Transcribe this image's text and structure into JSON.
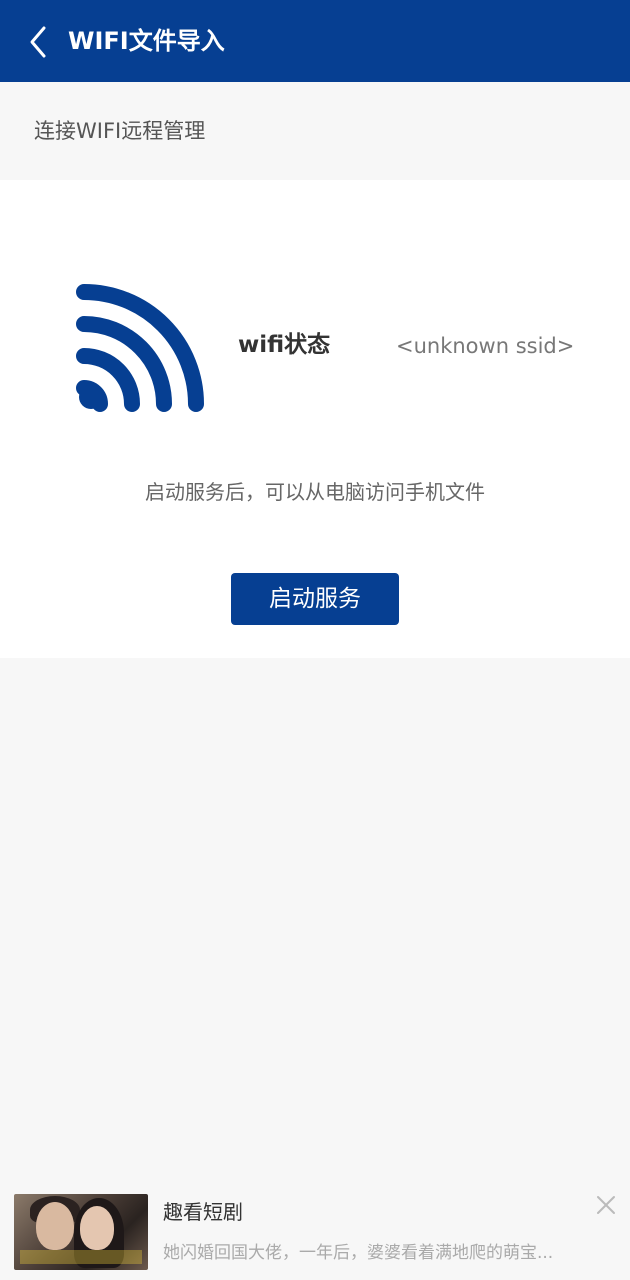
{
  "header": {
    "title": "WIFI文件导入",
    "back_icon": "chevron-left-icon",
    "background": "#063f92"
  },
  "subheader": {
    "text": "连接WIFI远程管理"
  },
  "status": {
    "wifi_icon": "wifi-icon",
    "label": "wifi状态",
    "ssid": "<unknown ssid>",
    "accent": "#063f92"
  },
  "hint": "启动服务后，可以从电脑访问手机文件",
  "start_button": {
    "label": "启动服务"
  },
  "ad": {
    "title": "趣看短剧",
    "description": "她闪婚回国大佬，一年后，婆婆看着满地爬的萌宝...",
    "close_icon": "close-icon",
    "thumbnail": "drama-thumbnail"
  }
}
